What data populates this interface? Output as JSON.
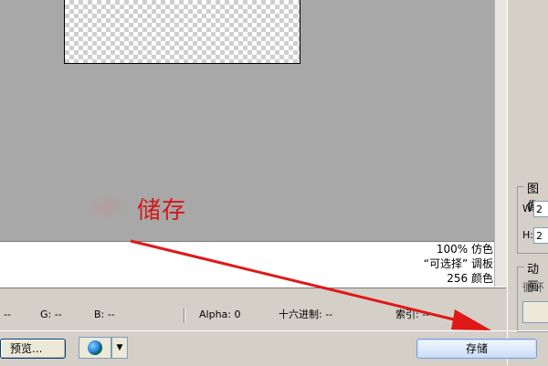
{
  "info": {
    "dither": "100% 仿色",
    "palette": "“可选择” 调板",
    "colors": "256 颜色"
  },
  "status": {
    "r": "--",
    "g": "G: --",
    "b": "B: --",
    "alpha": "Alpha: 0",
    "hex": "十六进制: --",
    "index": "索引: --"
  },
  "right": {
    "image_group_title": "图像",
    "w_label": "W:",
    "w_value": "2",
    "h_label": "H:",
    "h_value": "2",
    "anim_group_title": "动画",
    "loop_label": "循环"
  },
  "buttons": {
    "preview": "预览...",
    "save": "存储"
  },
  "annotation": {
    "text": "储存",
    "color": "#d21a1a"
  },
  "icons": {
    "browser": "browser-globe-icon",
    "dropdown": "chevron-down-icon"
  }
}
